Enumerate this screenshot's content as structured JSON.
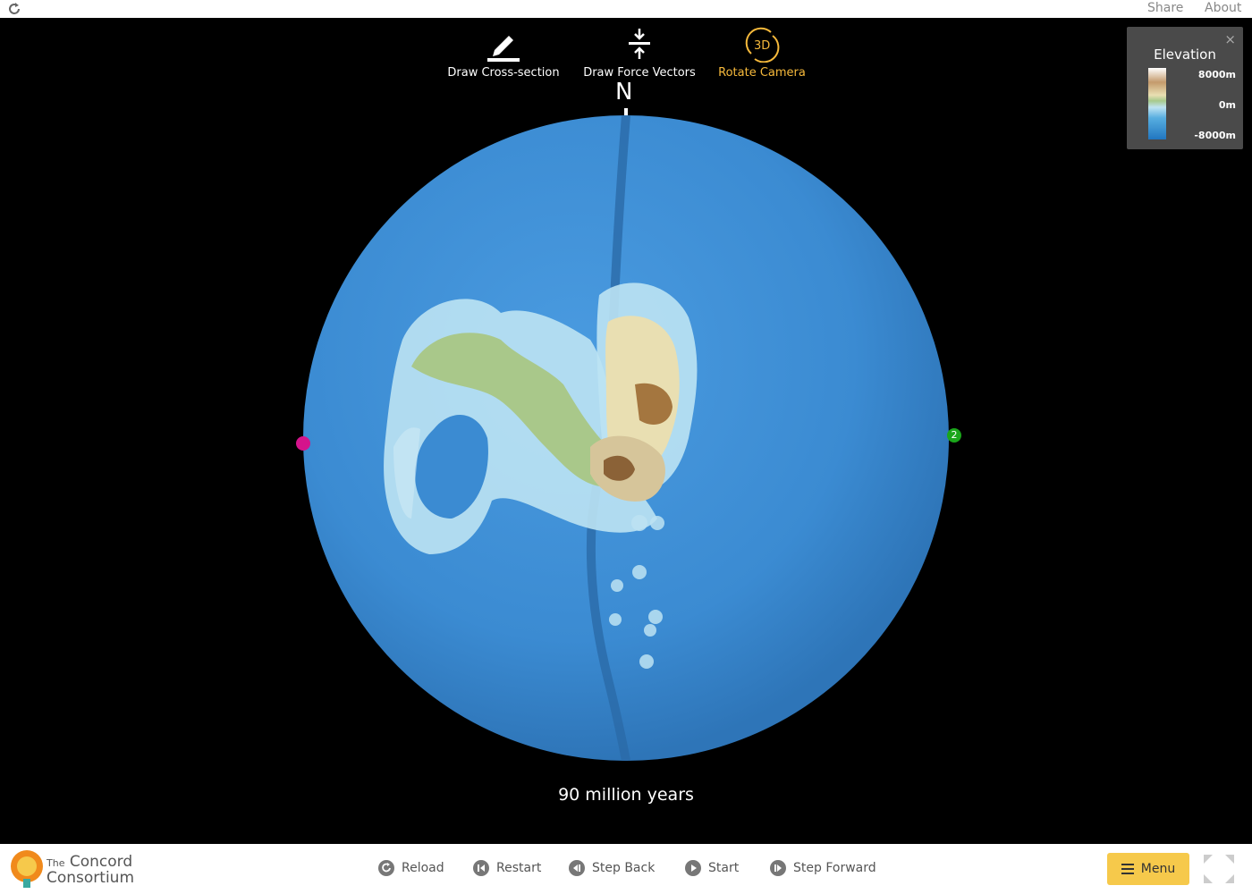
{
  "topbar": {
    "share": "Share",
    "about": "About"
  },
  "tools": [
    {
      "label": "Draw Cross-section",
      "icon": "pencil-icon",
      "active": false
    },
    {
      "label": "Draw Force Vectors",
      "icon": "compress-arrows-icon",
      "active": false
    },
    {
      "label": "Rotate Camera",
      "icon": "rotate-3d-icon",
      "active": true,
      "icon_text": "3D"
    }
  ],
  "compass": {
    "north": "N"
  },
  "legend": {
    "title": "Elevation",
    "max": "8000m",
    "mid": "0m",
    "min": "-8000m",
    "close": "×"
  },
  "plates": {
    "right_label": "2",
    "right_color": "#1aa61a",
    "left_color": "#d4148c"
  },
  "time": "90 million years",
  "logo": {
    "small": "The",
    "line1": "Concord",
    "line2": "Consortium"
  },
  "controls": {
    "reload": "Reload",
    "restart": "Restart",
    "step_back": "Step Back",
    "start": "Start",
    "step_forward": "Step Forward"
  },
  "menu": {
    "label": "Menu"
  },
  "colors": {
    "ocean": "#3d8fd6",
    "accent": "#f6b93b",
    "menu_bg": "#f6c94b"
  }
}
